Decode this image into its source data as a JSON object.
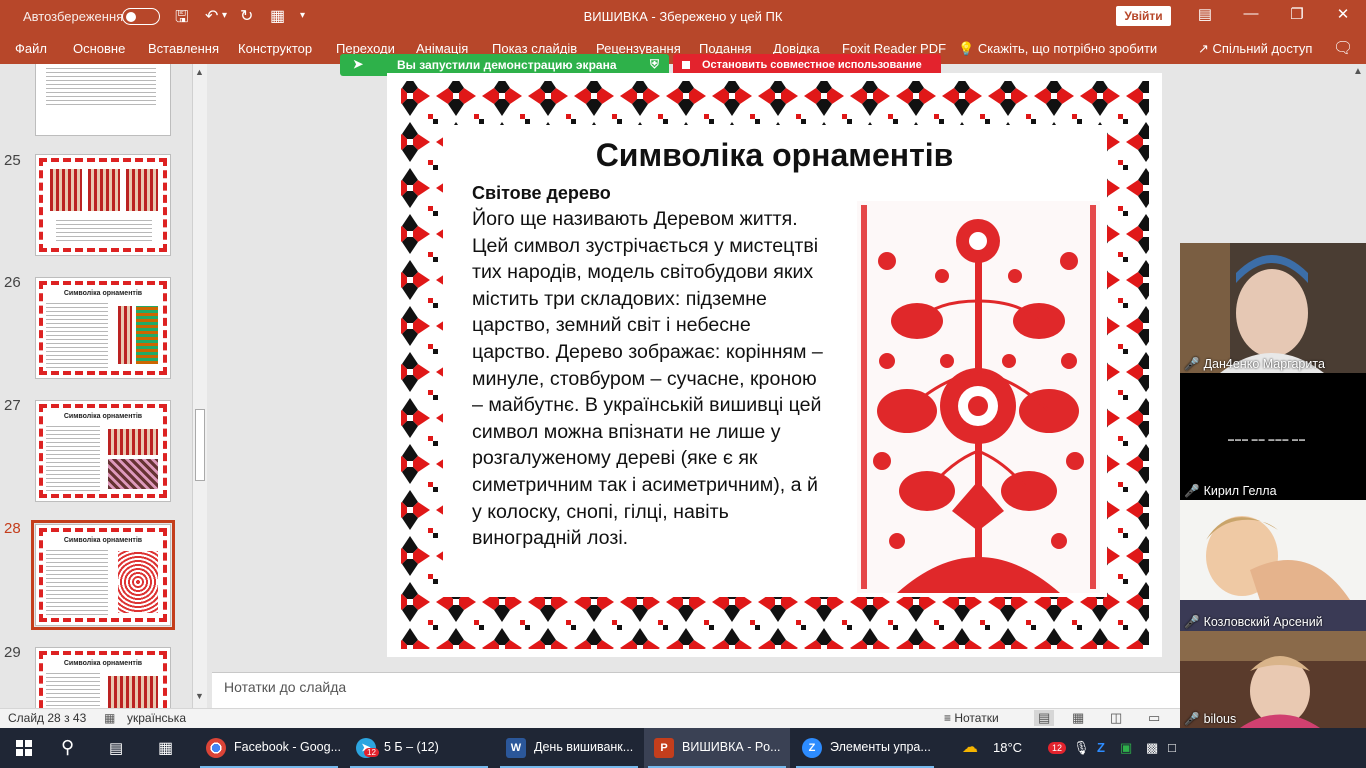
{
  "titlebar": {
    "autosave": "Автозбереження",
    "title": "ВИШИВКА  -  Збережено у цей ПК",
    "signin": "Увійти",
    "colors": {
      "accent": "#b7472a"
    }
  },
  "ribbon": {
    "tabs": [
      "Файл",
      "Основне",
      "Вставлення",
      "Конструктор",
      "Переходи",
      "Анімація",
      "Показ слайдів",
      "Рецензування",
      "Подання",
      "Довідка",
      "Foxit Reader PDF"
    ],
    "tell_me": "Скажіть, що потрібно зробити",
    "share": "Спільний доступ"
  },
  "screen_share": {
    "banner": "Вы запустили демонстрацию экрана",
    "stop": "Остановить совместное использование"
  },
  "thumbnails": [
    {
      "num": "25",
      "title": ""
    },
    {
      "num": "26",
      "title": "Символіка орнаментів"
    },
    {
      "num": "27",
      "title": "Символіка орнаментів"
    },
    {
      "num": "28",
      "title": "Символіка орнаментів",
      "active": true
    },
    {
      "num": "29",
      "title": "Символіка орнаментів"
    }
  ],
  "slide": {
    "title": "Символіка орнаментів",
    "subtitle": "Світове дерево",
    "body": "Його ще називають Деревом життя. Цей символ зустрічається у мистецтві тих народів, модель світобудови яких містить три складових: підземне царство, земний світ і небесне царство. Дерево зображає: корінням – минуле, стовбуром – сучасне, кроною – майбутнє. В українській вишивці цей символ можна впізнати не лише у розгалуженому дереві (яке є як симетричним так і асиметричним), а й у колоску, снопі, гілці, навіть виноградній лозі."
  },
  "notes": {
    "placeholder": "Нотатки до слайда"
  },
  "status": {
    "slide_counter": "Слайд 28 з 43",
    "language": "українська",
    "notes_btn": "Нотатки"
  },
  "participants": [
    {
      "name": "Дан4енко Маргарита",
      "muted": true
    },
    {
      "name": "Кирил Гелла",
      "muted": true
    },
    {
      "name": "Козловский Арсений",
      "muted": true
    },
    {
      "name": "bilous",
      "muted": true
    }
  ],
  "taskbar": {
    "tasks": [
      {
        "label": "Facebook - Goog...",
        "icon": "chrome-icon"
      },
      {
        "label": "5 Б – (12)",
        "icon": "telegram-icon",
        "badge": "12"
      },
      {
        "label": "День вишиванк...",
        "icon": "word-icon"
      },
      {
        "label": "ВИШИВКА - Po...",
        "icon": "powerpoint-icon",
        "active": true
      },
      {
        "label": "Элементы упра...",
        "icon": "zoom-icon"
      }
    ],
    "weather": "18°C",
    "badge": "12"
  }
}
